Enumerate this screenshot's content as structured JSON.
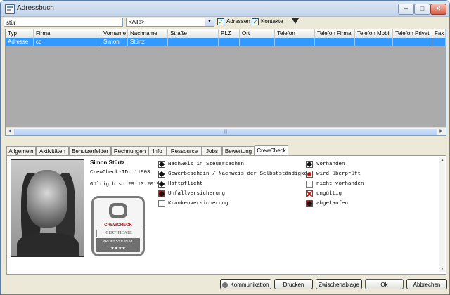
{
  "window": {
    "title": "Adressbuch",
    "minimize": "–",
    "maximize": "□",
    "close": "✕"
  },
  "toolbar": {
    "search_value": "stür",
    "filter_value": "<Alle>",
    "filter_arrow": "▼",
    "chk_adressen_label": "Adressen",
    "chk_adressen_checked": true,
    "chk_kontakte_label": "Kontakte",
    "chk_kontakte_checked": true,
    "filter_icon": "funnel-icon"
  },
  "grid": {
    "columns": [
      "Typ",
      "Firma",
      "Vorname",
      "Nachname",
      "Straße",
      "PLZ",
      "Ort",
      "Telefon",
      "Telefon Firma",
      "Telefon Mobil",
      "Telefon Privat",
      "Fax"
    ],
    "rows": [
      [
        "Adresse",
        "cc",
        "Simon",
        "Stürtz",
        "",
        "",
        "",
        "",
        "",
        "",
        "",
        ""
      ]
    ],
    "scroll_left": "◀",
    "scroll_right": "▶",
    "scroll_grip": "|||"
  },
  "tabs": [
    "Allgemein",
    "Aktivitäten",
    "Benutzerfelder",
    "Rechnungen",
    "Info",
    "Ressource",
    "Jobs",
    "Bewertung",
    "CrewCheck"
  ],
  "active_tab": "CrewCheck",
  "crewcheck": {
    "name": "Simon Stürtz",
    "id_line": "CrewCheck-ID: 11903",
    "valid_line": "Gültig bis: 29.10.2010",
    "cert": {
      "brand": "CREWCHECK",
      "certificate": "CERTIFICATE",
      "level": "PROFESSIONAL",
      "stars": "★★★★"
    },
    "checks": [
      {
        "label": "Nachweis in Steuersachen",
        "status": "vorhanden"
      },
      {
        "label": "Gewerbeschein / Nachweis der Selbstständigkeit",
        "status": "vorhanden"
      },
      {
        "label": "Haftpflicht",
        "status": "vorhanden"
      },
      {
        "label": "Unfallversicherung",
        "status": "abgelaufen"
      },
      {
        "label": "Krankenversicherung",
        "status": "nicht vorhanden"
      }
    ],
    "legend": [
      {
        "label": "vorhanden",
        "icon": "present-icon"
      },
      {
        "label": "wird überprüft",
        "icon": "pending-icon"
      },
      {
        "label": "nicht vorhanden",
        "icon": "absent-icon"
      },
      {
        "label": "ungültig",
        "icon": "invalid-icon"
      },
      {
        "label": "abgelaufen",
        "icon": "expired-icon"
      }
    ],
    "scroll_up": "▲",
    "scroll_down": "▼"
  },
  "buttons": {
    "kommunikation": "Kommunikation",
    "drucken": "Drucken",
    "zwischenablage": "Zwischenablage",
    "ok": "Ok",
    "abbrechen": "Abbrechen"
  }
}
